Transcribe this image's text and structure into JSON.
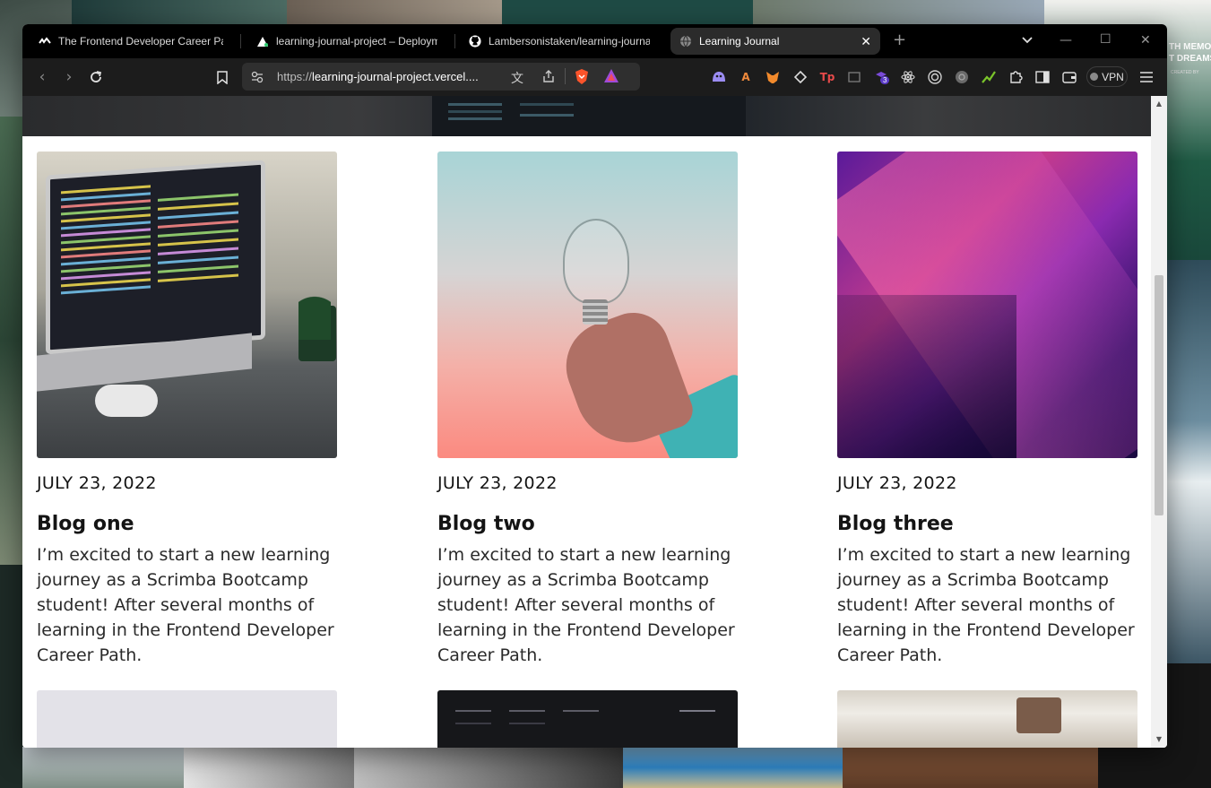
{
  "wallpaper": {
    "poster_text_line1": "TH MEMOR",
    "poster_text_line2": "T DREAMS",
    "poster_caption": "CREATED BY"
  },
  "tabs": [
    {
      "title": "The Frontend Developer Career Path",
      "icon": "scrimba-icon"
    },
    {
      "title": "learning-journal-project – Deployment",
      "icon": "vercel-icon"
    },
    {
      "title": "Lambersonistaken/learning-journal-project",
      "icon": "github-icon"
    },
    {
      "title": "Learning Journal",
      "icon": "globe-icon",
      "active": true
    }
  ],
  "toolbar": {
    "url_prefix": "https://",
    "url_host": "learning-journal-project.vercel....",
    "vpn_label": "VPN",
    "badge_count": "3"
  },
  "posts": [
    {
      "date": "JULY 23, 2022",
      "title": "Blog one",
      "text": "I’m excited to start a new learning journey as a Scrimba Bootcamp student! After several months of learning in the Frontend Developer Career Path."
    },
    {
      "date": "JULY 23, 2022",
      "title": "Blog two",
      "text": "I’m excited to start a new learning journey as a Scrimba Bootcamp student! After several months of learning in the Frontend Developer Career Path."
    },
    {
      "date": "JULY 23, 2022",
      "title": "Blog three",
      "text": "I’m excited to start a new learning journey as a Scrimba Bootcamp student! After several months of learning in the Frontend Developer Career Path."
    }
  ],
  "colors": {
    "tabbar_bg": "#000000",
    "toolbar_bg": "#1c1c1c",
    "page_bg": "#ffffff",
    "text": "#141414",
    "sleeve": "#3fb2b4"
  }
}
